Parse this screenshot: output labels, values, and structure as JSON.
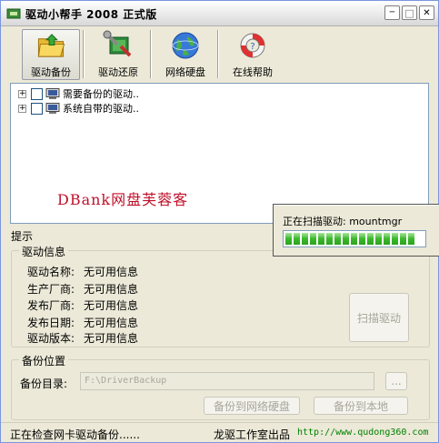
{
  "window": {
    "title": "驱动小帮手 2008 正式版"
  },
  "titlebar_buttons": {
    "minimize": "─",
    "maximize": "□",
    "close": "✕"
  },
  "toolbar": [
    {
      "label": "驱动备份",
      "icon": "folder-icon",
      "active": true
    },
    {
      "label": "驱动还原",
      "icon": "tools-icon",
      "active": false
    },
    {
      "label": "网络硬盘",
      "icon": "globe-icon",
      "active": false
    },
    {
      "label": "在线帮助",
      "icon": "lifebuoy-icon",
      "active": false
    }
  ],
  "tree": [
    {
      "expander": "+",
      "label": "需要备份的驱动.."
    },
    {
      "expander": "+",
      "label": "系统自带的驱动.."
    }
  ],
  "watermark": "DBank网盘芙蓉客",
  "tip_label": "提示",
  "driver_info": {
    "group_title": "驱动信息",
    "rows": [
      {
        "key": "驱动名称:",
        "value": "无可用信息"
      },
      {
        "key": "生产厂商:",
        "value": "无可用信息"
      },
      {
        "key": "发布厂商:",
        "value": "无可用信息"
      },
      {
        "key": "发布日期:",
        "value": "无可用信息"
      },
      {
        "key": "驱动版本:",
        "value": "无可用信息"
      }
    ],
    "scan_button": "扫描驱动"
  },
  "backup": {
    "group_title": "备份位置",
    "dir_label": "备份目录:",
    "dir_value": "F:\\DriverBackup",
    "browse_label": "...",
    "to_netdisk": "备份到网络硬盘",
    "to_local": "备份到本地"
  },
  "status": {
    "text": "正在检查网卡驱动备份......",
    "company": "龙驱工作室出品",
    "url": "http://www.qudong360.com"
  },
  "popup": {
    "label": "正在扫描驱动: mountmgr",
    "segments": 16
  }
}
